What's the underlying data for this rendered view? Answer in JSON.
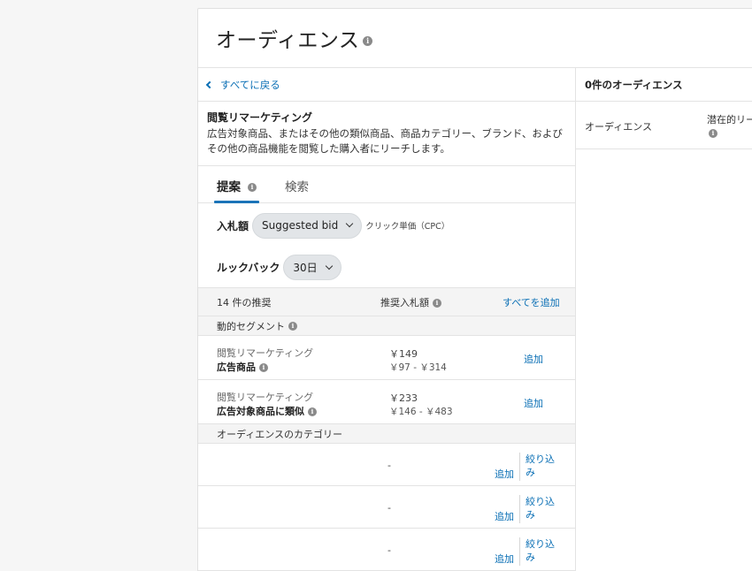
{
  "header": {
    "title": "オーディエンス"
  },
  "left": {
    "back_link": "すべてに戻る",
    "description": {
      "title": "閲覧リマーケティング",
      "text": "広告対象商品、またはその他の類似商品、商品カテゴリー、ブランド、およびその他の商品機能を閲覧した購入者にリーチします。"
    },
    "tabs": [
      {
        "label": "提案",
        "active": true
      },
      {
        "label": "検索",
        "active": false
      }
    ],
    "bid": {
      "label": "入札額",
      "value": "Suggested bid",
      "note": "クリック単価（CPC）"
    },
    "lookback": {
      "label": "ルックバック",
      "value": "30日"
    },
    "rec_header": {
      "count": "14 件の推奨",
      "bid_col": "推奨入札額",
      "add_all": "すべてを追加"
    },
    "dynamic_section": "動的セグメント",
    "dynamic_rows": [
      {
        "line1": "閲覧リマーケティング",
        "line2": "広告商品",
        "price": "￥149",
        "range": "￥97 - ￥314",
        "action": "追加"
      },
      {
        "line1": "閲覧リマーケティング",
        "line2": "広告対象商品に類似",
        "price": "￥233",
        "range": "￥146 - ￥483",
        "action": "追加"
      }
    ],
    "category_section": "オーディエンスのカテゴリー",
    "category_rows": [
      {
        "bid": "-",
        "add": "追加",
        "refine": "絞り込み"
      },
      {
        "bid": "-",
        "add": "追加",
        "refine": "絞り込み"
      },
      {
        "bid": "-",
        "add": "追加",
        "refine": "絞り込み"
      }
    ]
  },
  "right": {
    "header": "0件のオーディエンス",
    "col_audience": "オーディエンス",
    "col_potential": "潜在的リー"
  },
  "icons": {
    "info": "info-icon",
    "back": "chevron-left-icon",
    "dropdown": "chevron-down-icon"
  }
}
